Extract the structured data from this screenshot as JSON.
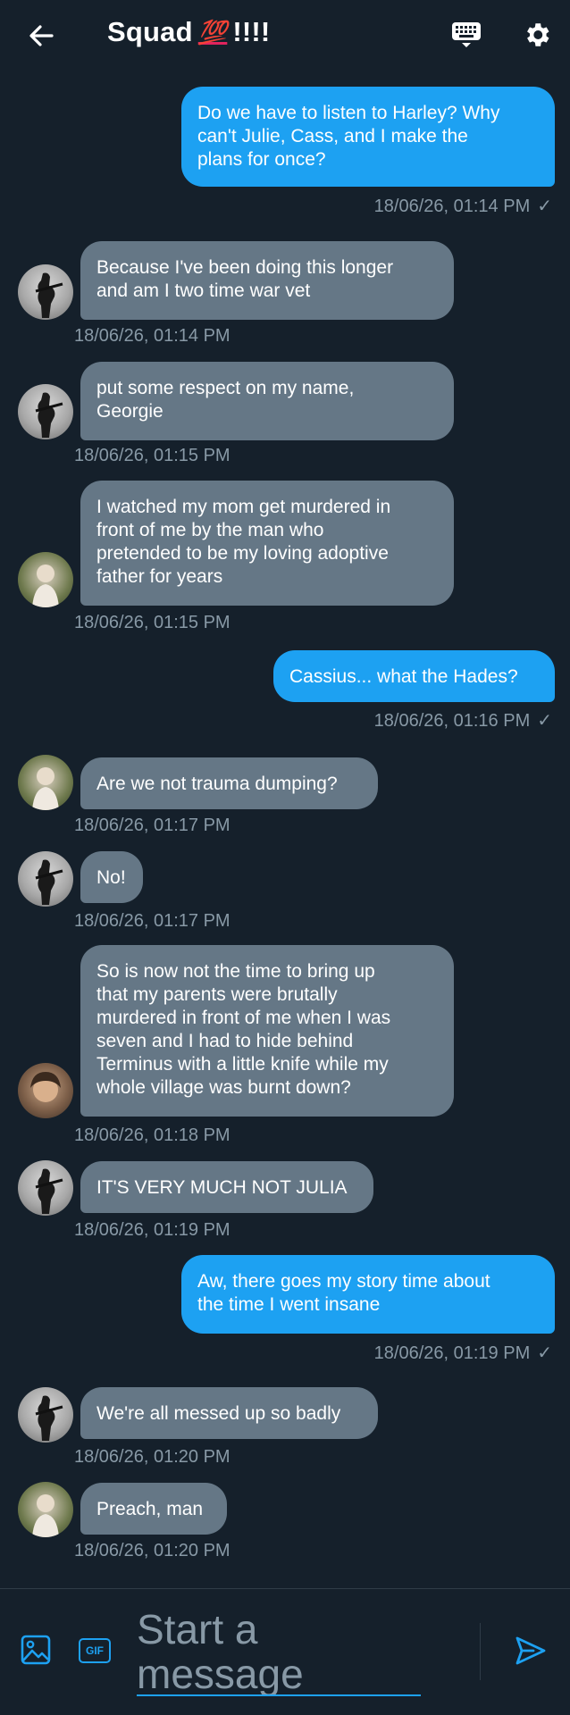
{
  "header": {
    "title": "Squad",
    "emoji": "💯",
    "title_suffix": "!!!!",
    "icons": {
      "back": "arrow-left-icon",
      "keyboard": "keyboard-icon",
      "settings": "gear-icon"
    }
  },
  "colors": {
    "background": "#15202b",
    "outgoing_bubble": "#1da1f2",
    "incoming_bubble": "#657786",
    "timestamp": "#8899a6",
    "accent": "#1da1f2"
  },
  "messages": [
    {
      "direction": "out",
      "lines": [
        "Do we have to listen to Harley? Why",
        "can't Julie, Cass, and I make the",
        "plans for once?"
      ],
      "timestamp": "18/06/26, 01:14 PM",
      "read": "✓"
    },
    {
      "direction": "in",
      "sender": "harley",
      "lines": [
        "Because I've been doing this longer",
        "and am I two time war vet"
      ],
      "timestamp": "18/06/26, 01:14 PM"
    },
    {
      "direction": "in",
      "sender": "harley",
      "lines": [
        "put some respect on my name,",
        "Georgie"
      ],
      "timestamp": "18/06/26, 01:15 PM"
    },
    {
      "direction": "in",
      "sender": "cassius",
      "lines": [
        "I watched my mom get murdered in",
        "front of me by the man who",
        "pretended to be my loving adoptive",
        "father for years"
      ],
      "timestamp": "18/06/26, 01:15 PM"
    },
    {
      "direction": "out",
      "lines": [
        "Cassius... what the Hades?"
      ],
      "timestamp": "18/06/26, 01:16 PM",
      "read": "✓"
    },
    {
      "direction": "in",
      "sender": "cassius",
      "lines": [
        "Are we not trauma dumping?"
      ],
      "timestamp": "18/06/26, 01:17 PM"
    },
    {
      "direction": "in",
      "sender": "harley",
      "lines": [
        "No!"
      ],
      "timestamp": "18/06/26, 01:17 PM"
    },
    {
      "direction": "in",
      "sender": "julia",
      "lines": [
        "So is now not the time to bring up",
        "that my parents were brutally",
        "murdered in front of me when I was",
        "seven and I had to hide behind",
        "Terminus with a little knife while my",
        "whole village was burnt down?"
      ],
      "timestamp": "18/06/26, 01:18 PM"
    },
    {
      "direction": "in",
      "sender": "harley",
      "lines": [
        "IT'S VERY MUCH NOT JULIA"
      ],
      "timestamp": "18/06/26, 01:19 PM"
    },
    {
      "direction": "out",
      "lines": [
        "Aw, there goes my story time about",
        "the time I went insane"
      ],
      "timestamp": "18/06/26, 01:19 PM",
      "read": "✓"
    },
    {
      "direction": "in",
      "sender": "harley",
      "lines": [
        "We're all messed up so badly"
      ],
      "timestamp": "18/06/26, 01:20 PM"
    },
    {
      "direction": "in",
      "sender": "cassius",
      "lines": [
        "Preach, man"
      ],
      "timestamp": "18/06/26, 01:20 PM"
    }
  ],
  "composer": {
    "placeholder_line1": "Start a",
    "placeholder_line2": "message",
    "gif_label": "GIF",
    "icons": {
      "image": "image-icon",
      "send": "send-icon"
    }
  }
}
